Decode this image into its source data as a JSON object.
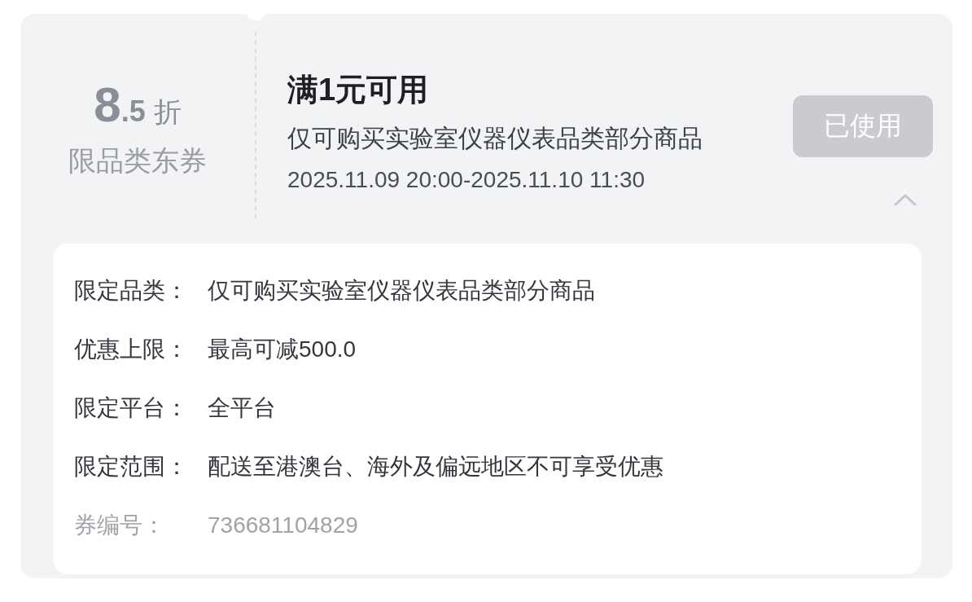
{
  "coupon": {
    "discount_integer": "8",
    "discount_decimal": ".5",
    "discount_unit": "折",
    "type_label": "限品类东券",
    "title": "满1元可用",
    "scope": "仅可购买实验室仪器仪表品类部分商品",
    "validity": "2025.11.09 20:00-2025.11.10 11:30",
    "status_button": "已使用",
    "used": true,
    "expanded": true
  },
  "details": [
    {
      "label": "限定品类：",
      "value": "仅可购买实验室仪器仪表品类部分商品",
      "kind": "normal"
    },
    {
      "label": "优惠上限：",
      "value": "最高可减500.0",
      "kind": "normal"
    },
    {
      "label": "限定平台：",
      "value": "全平台",
      "kind": "normal"
    },
    {
      "label": "限定范围：",
      "value": "配送至港澳台、海外及偏远地区不可享受优惠",
      "kind": "normal"
    },
    {
      "label": "券编号：",
      "value": "736681104829",
      "kind": "muted"
    }
  ]
}
